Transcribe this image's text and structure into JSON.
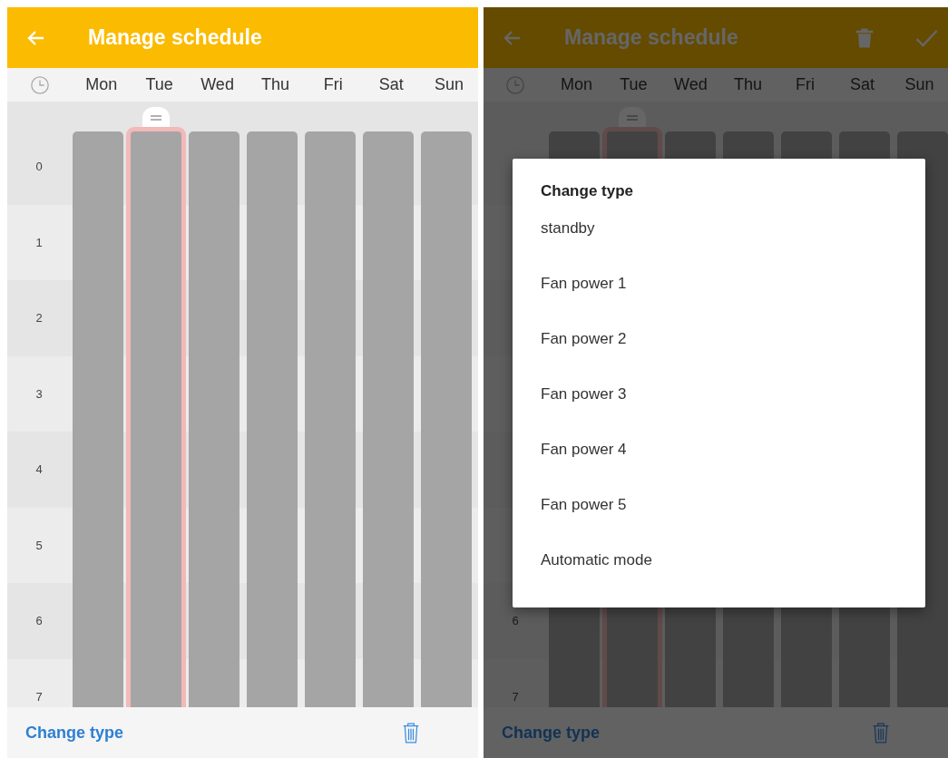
{
  "screens": [
    {
      "title": "Manage schedule",
      "days": [
        {
          "label": "Mon",
          "selected": false
        },
        {
          "label": "Tue",
          "selected": true
        },
        {
          "label": "Wed",
          "selected": false
        },
        {
          "label": "Thu",
          "selected": false
        },
        {
          "label": "Fri",
          "selected": false
        },
        {
          "label": "Sat",
          "selected": false
        },
        {
          "label": "Sun",
          "selected": false
        }
      ],
      "hours": [
        "0",
        "1",
        "2",
        "3",
        "4",
        "5",
        "6",
        "7"
      ],
      "bottom_action": "Change type",
      "dimmed": false
    },
    {
      "title": "Manage schedule",
      "actions": [
        {
          "kind": "delete"
        },
        {
          "kind": "confirm"
        }
      ],
      "days": [
        {
          "label": "Mon",
          "selected": false
        },
        {
          "label": "Tue",
          "selected": true
        },
        {
          "label": "Wed",
          "selected": false
        },
        {
          "label": "Thu",
          "selected": false
        },
        {
          "label": "Fri",
          "selected": false
        },
        {
          "label": "Sat",
          "selected": false
        },
        {
          "label": "Sun",
          "selected": false
        }
      ],
      "hours": [
        "6",
        "7"
      ],
      "bottom_action": "Change type",
      "dimmed": true,
      "dialog": {
        "title": "Change type",
        "options": [
          "standby",
          "Fan power 1",
          "Fan power 2",
          "Fan power 3",
          "Fan power 4",
          "Fan power 5",
          "Automatic mode"
        ]
      }
    }
  ]
}
